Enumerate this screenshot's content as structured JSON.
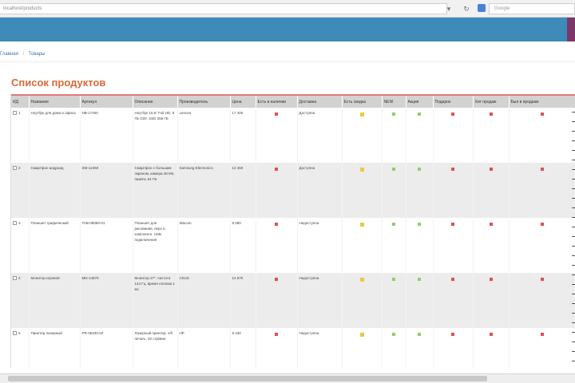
{
  "browser": {
    "url": "localhost/products",
    "search_placeholder": "Google"
  },
  "breadcrumb": {
    "items": [
      "Главная",
      "Товары"
    ],
    "separator": "/"
  },
  "page": {
    "title": "Список продуктов"
  },
  "table": {
    "headers": [
      "ИД",
      "Название",
      "Артикул",
      "Описание",
      "Производитель",
      "Цена",
      "Есть в наличии",
      "Доставка",
      "Есть скидка",
      "NEW",
      "Акция",
      "Подарок",
      "Хит продаж",
      "Был в продаже"
    ],
    "rows": [
      {
        "id": "1",
        "name": "Ноутбук для дома и офиса",
        "sku": "NB-17400",
        "description": "Ноутбук 15.6\" Full HD, 8 ГБ ОЗУ, SSD 256 ГБ",
        "maker": "Lenovo",
        "price": "17 400",
        "delivery": "Доступна"
      },
      {
        "id": "2",
        "name": "Смартфон андроид",
        "sku": "SM-12450",
        "description": "Смартфон с большим экраном, камера 48 Мп, память 64 ГБ",
        "maker": "Samsung Electronics",
        "price": "12 450",
        "delivery": "Доступна"
      },
      {
        "id": "3",
        "name": "Планшет графический",
        "sku": "TAB-08080-01",
        "description": "Планшет для рисования, перо в комплекте, USB подключение",
        "maker": "Wacom",
        "price": "8 080",
        "delivery": "Недоступна"
      },
      {
        "id": "4",
        "name": "Монитор игровой",
        "sku": "MN-14870",
        "description": "Монитор 27\", частота 144 Гц, время отклика 1 мс",
        "maker": "ASUS",
        "price": "14 870",
        "delivery": "Недоступна"
      },
      {
        "id": "5",
        "name": "Принтер лазерный",
        "sku": "PR-06430-02",
        "description": "Лазерный принтер, ч/б печать, 20 стр/мин",
        "maker": "HP",
        "price": "6 430",
        "delivery": "Недоступна"
      }
    ]
  },
  "colors": {
    "header_blue": "#3e8ab8",
    "header_accent": "#7a3868",
    "title_orange": "#d56a3a",
    "status_red": "#e05050",
    "status_green": "#8cd06a",
    "status_warn": "#e8c94a"
  }
}
